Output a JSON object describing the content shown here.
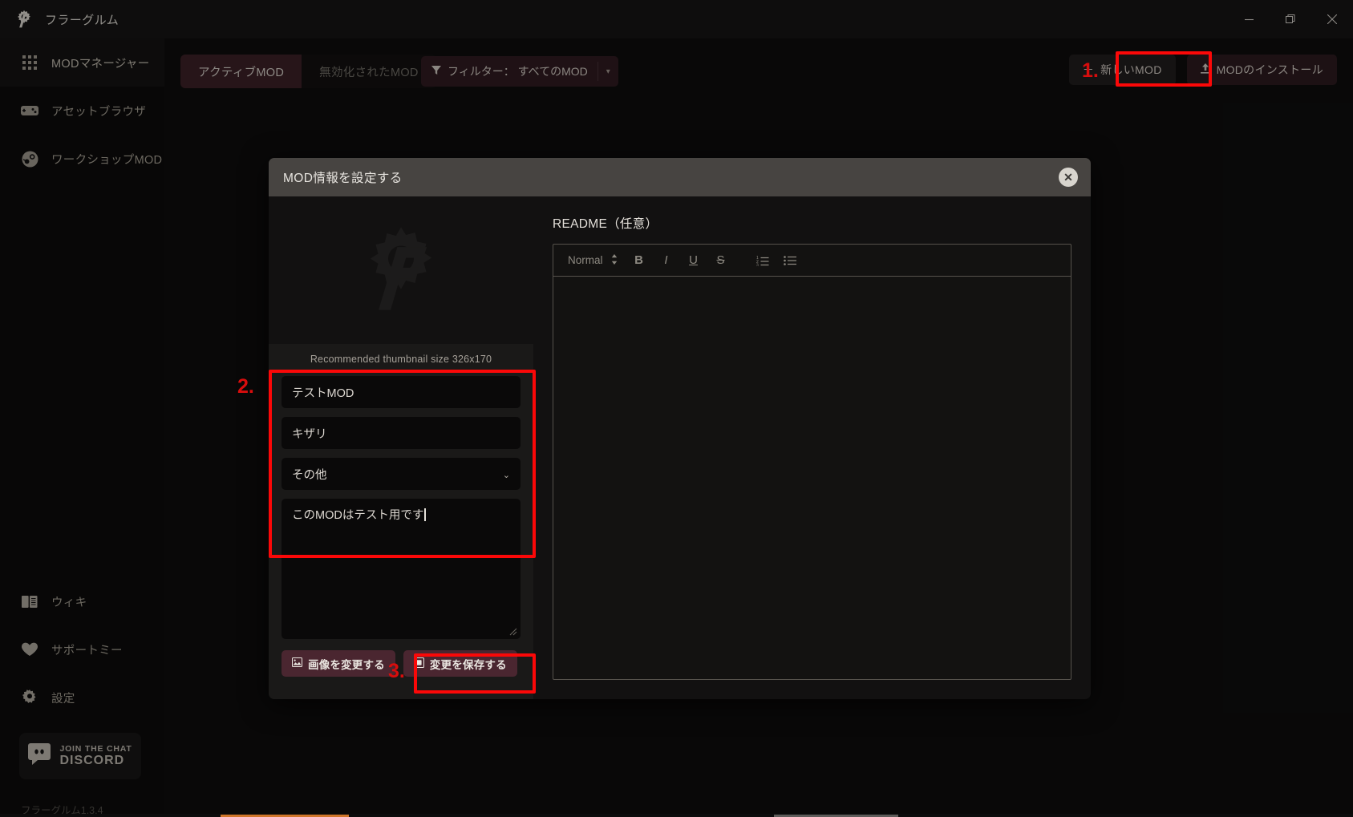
{
  "window": {
    "title": "フラーグルム",
    "logo_icon": "gear-f-logo-icon",
    "minimize_icon": "minimize-icon",
    "maximize_icon": "maximize-icon",
    "close_icon": "close-icon"
  },
  "sidebar": {
    "items": [
      {
        "label": "MODマネージャー",
        "icon": "grid-icon",
        "active": true
      },
      {
        "label": "アセットブラウザ",
        "icon": "gamepad-icon",
        "active": false
      },
      {
        "label": "ワークショップMOD",
        "icon": "steam-icon",
        "active": false
      }
    ],
    "bottom_items": [
      {
        "label": "ウィキ",
        "icon": "book-icon"
      },
      {
        "label": "サポートミー",
        "icon": "heart-icon"
      },
      {
        "label": "設定",
        "icon": "gear-icon"
      }
    ],
    "discord": {
      "line1": "JOIN THE CHAT",
      "line2": "DISCORD",
      "icon": "discord-icon"
    },
    "version": "フラーグルム1.3.4"
  },
  "toolbar": {
    "tabs": [
      {
        "label": "アクティブMOD",
        "active": true
      },
      {
        "label": "無効化されたMOD",
        "active": false
      }
    ],
    "filter": {
      "icon": "filter-icon",
      "label": "フィルター： すべてのMOD",
      "caret_icon": "chevron-down-icon"
    },
    "new_mod_button": {
      "label": "新しいMOD",
      "icon": "plus-icon"
    },
    "install_mod_button": {
      "label": "MODのインストール",
      "icon": "upload-icon"
    }
  },
  "modal": {
    "title": "MOD情報を設定する",
    "close_icon": "close-circle-icon",
    "thumbnail": {
      "placeholder_icon": "gear-f-logo-icon",
      "hint": "Recommended thumbnail size 326x170"
    },
    "fields": {
      "name_value": "テストMOD",
      "author_value": "キザリ",
      "category_value": "その他",
      "category_caret": "chevron-down-icon",
      "description_value": "このMODはテスト用です"
    },
    "buttons": {
      "change_image": {
        "label": "画像を変更する",
        "icon": "image-icon"
      },
      "save_changes": {
        "label": "変更を保存する",
        "icon": "save-icon"
      }
    },
    "readme": {
      "label": "README（任意）",
      "toolbar": {
        "format_value": "Normal",
        "format_caret": "updown-caret-icon",
        "bold": "B",
        "italic": "I",
        "underline": "U",
        "strike": "S",
        "ordered_list": "ordered-list-icon",
        "bullet_list": "bullet-list-icon"
      },
      "content": ""
    }
  },
  "annotations": [
    {
      "number": "1."
    },
    {
      "number": "2."
    },
    {
      "number": "3."
    }
  ],
  "colors": {
    "accent": "#4a2630",
    "annotation": "#fb0808",
    "window_bg": "#0e0d0d",
    "modal_header": "#474441"
  }
}
